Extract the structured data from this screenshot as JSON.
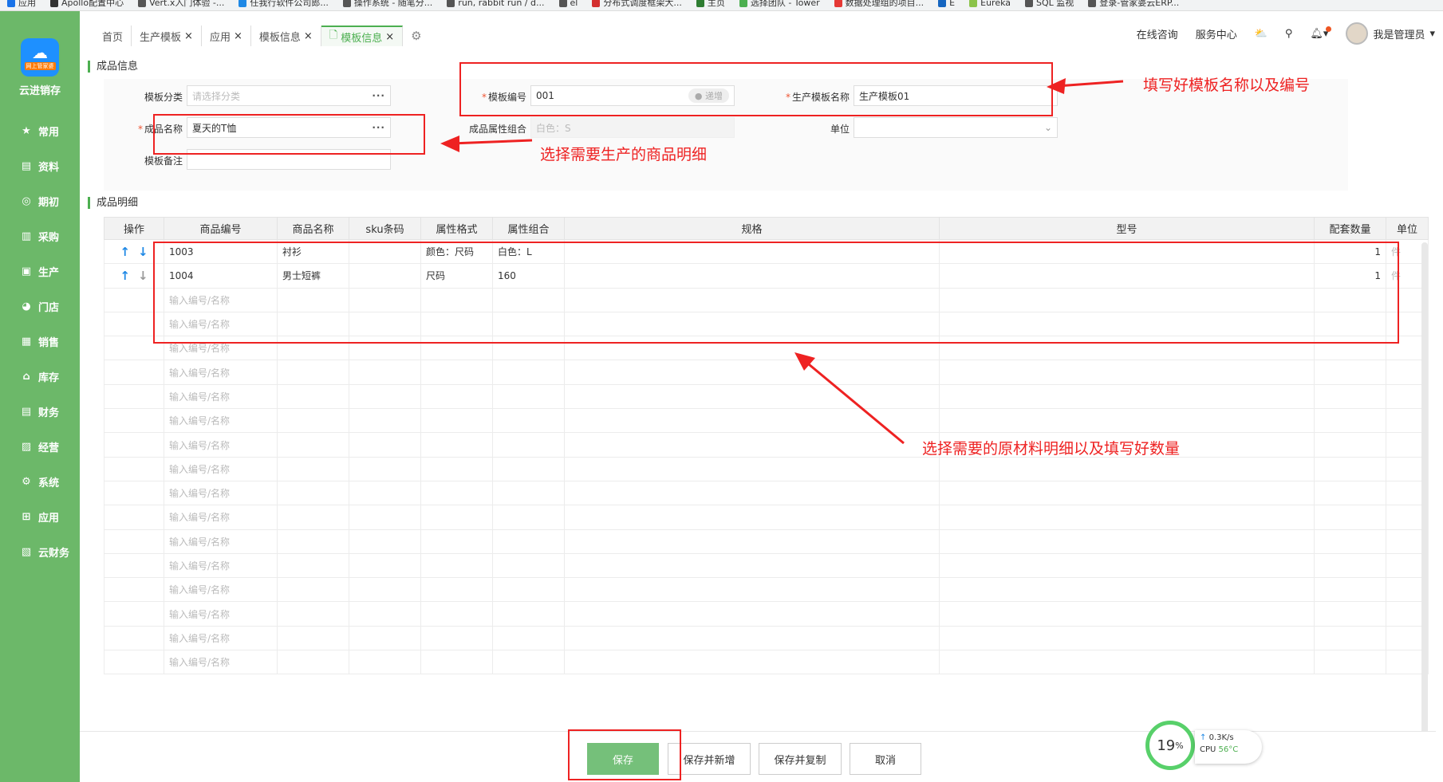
{
  "bookmarks": [
    "应用",
    "Apollo配置中心",
    "Vert.x入门体验 -...",
    "任我行软件公司郎...",
    "操作系统 - 随笔分...",
    "run, rabbit run / d...",
    "el",
    "分布式调度框架大...",
    "主页",
    "选择团队 - Tower",
    "数据处理组的项目...",
    "E",
    "Eureka",
    "SQL 监视",
    "登录-管家婆云ERP..."
  ],
  "sidebar": {
    "logo_badge": "网上管家婆",
    "brand": "云进销存",
    "items": [
      {
        "label": "常用",
        "icon": "star-icon"
      },
      {
        "label": "资料",
        "icon": "document-icon"
      },
      {
        "label": "期初",
        "icon": "target-icon"
      },
      {
        "label": "采购",
        "icon": "purchase-icon"
      },
      {
        "label": "生产",
        "icon": "production-icon"
      },
      {
        "label": "门店",
        "icon": "store-icon"
      },
      {
        "label": "销售",
        "icon": "sales-icon"
      },
      {
        "label": "库存",
        "icon": "warehouse-icon"
      },
      {
        "label": "财务",
        "icon": "finance-icon"
      },
      {
        "label": "经营",
        "icon": "business-icon"
      },
      {
        "label": "系统",
        "icon": "system-icon"
      },
      {
        "label": "应用",
        "icon": "apps-icon"
      },
      {
        "label": "云财务",
        "icon": "cloud-finance-icon"
      }
    ]
  },
  "tabs": [
    {
      "label": "首页",
      "closable": false,
      "active": false
    },
    {
      "label": "生产模板",
      "closable": true,
      "active": false
    },
    {
      "label": "应用",
      "closable": true,
      "active": false
    },
    {
      "label": "模板信息",
      "closable": true,
      "active": false
    },
    {
      "label": "模板信息",
      "closable": true,
      "active": true
    }
  ],
  "topright": {
    "consult": "在线咨询",
    "service": "服务中心",
    "username": "我是管理员"
  },
  "finished_info": {
    "section_title": "成品信息",
    "category_label": "模板分类",
    "category_placeholder": "请选择分类",
    "product_label": "成品名称",
    "product_value": "夏天的T恤",
    "remark_label": "模板备注",
    "remark_value": "",
    "code_label": "模板编号",
    "code_value": "001",
    "code_chip": "递增",
    "attr_label": "成品属性组合",
    "attr_value": "白色：S",
    "name_label": "生产模板名称",
    "name_value": "生产模板01",
    "unit_label": "单位",
    "unit_value": ""
  },
  "detail": {
    "section_title": "成品明细",
    "columns": [
      "操作",
      "商品编号",
      "商品名称",
      "sku条码",
      "属性格式",
      "属性组合",
      "规格",
      "型号",
      "配套数量",
      "单位"
    ],
    "rows": [
      {
        "code": "1003",
        "name": "衬衫",
        "sku": "",
        "format": "颜色：尺码",
        "combo": "白色：L",
        "spec": "",
        "model": "",
        "qty": "1",
        "unit": "件"
      },
      {
        "code": "1004",
        "name": "男士短裤",
        "sku": "",
        "format": "尺码",
        "combo": "160",
        "spec": "",
        "model": "",
        "qty": "1",
        "unit": "件"
      }
    ],
    "empty_placeholder": "输入编号/名称",
    "empty_rows": 16
  },
  "actions": {
    "save": "保存",
    "save_new": "保存并新增",
    "save_copy": "保存并复制",
    "cancel": "取消"
  },
  "annotations": {
    "name_and_code": "填写好模板名称以及编号",
    "select_product": "选择需要生产的商品明细",
    "select_materials": "选择需要的原材料明细以及填写好数量"
  },
  "monitor": {
    "cpu_percent": "19",
    "percent_sign": "%",
    "net_speed": "0.3K/s",
    "cpu_label": "CPU",
    "cpu_temp": "56°C"
  },
  "colors": {
    "sidebar": "#6cb869",
    "accent": "#4caf50",
    "annotation": "#ee2222",
    "arrow_blue": "#1e88e5"
  }
}
